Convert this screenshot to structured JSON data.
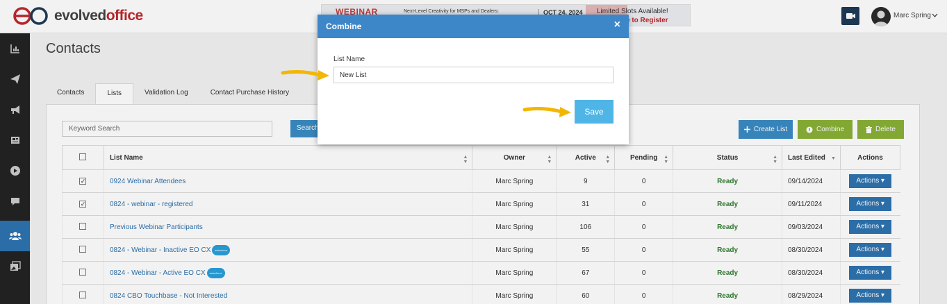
{
  "header": {
    "logo_prefix": "evolved",
    "logo_suffix": "office",
    "banner": {
      "tag": "WEBINAR",
      "description": "Next-Level Creativity for MSPs and Dealers:",
      "date": "OCT 24, 2024",
      "limited": "Limited Slots Available!",
      "register": "e to Register"
    },
    "user_name": "Marc Spring"
  },
  "sidebar": {
    "icons": [
      "dashboard-icon",
      "send-icon",
      "megaphone-icon",
      "newspaper-icon",
      "play-icon",
      "chat-icon",
      "contacts-icon",
      "gallery-icon"
    ],
    "active": "contacts-icon"
  },
  "page": {
    "title": "Contacts"
  },
  "tabs": [
    {
      "label": "Contacts",
      "active": false
    },
    {
      "label": "Lists",
      "active": true
    },
    {
      "label": "Validation Log",
      "active": false
    },
    {
      "label": "Contact Purchase History",
      "active": false
    }
  ],
  "toolbar": {
    "keyword_placeholder": "Keyword Search",
    "search_label": "Search",
    "create_label": "Create List",
    "combine_label": "Combine",
    "delete_label": "Delete"
  },
  "table": {
    "columns": [
      "List Name",
      "Owner",
      "Active",
      "Pending",
      "Status",
      "Last Edited",
      "Actions"
    ],
    "rows": [
      {
        "checked": true,
        "name": "0924 Webinar Attendees",
        "salesforce": false,
        "owner": "Marc Spring",
        "active": "9",
        "pending": "0",
        "status": "Ready",
        "last_edited": "09/14/2024",
        "action": "Actions"
      },
      {
        "checked": true,
        "name": "0824 - webinar - registered",
        "salesforce": false,
        "owner": "Marc Spring",
        "active": "31",
        "pending": "0",
        "status": "Ready",
        "last_edited": "09/11/2024",
        "action": "Actions"
      },
      {
        "checked": false,
        "name": "Previous Webinar Participants",
        "salesforce": false,
        "owner": "Marc Spring",
        "active": "106",
        "pending": "0",
        "status": "Ready",
        "last_edited": "09/03/2024",
        "action": "Actions"
      },
      {
        "checked": false,
        "name": "0824 - Webinar - Inactive EO CX",
        "salesforce": true,
        "owner": "Marc Spring",
        "active": "55",
        "pending": "0",
        "status": "Ready",
        "last_edited": "08/30/2024",
        "action": "Actions"
      },
      {
        "checked": false,
        "name": "0824 - Webinar - Active EO CX",
        "salesforce": true,
        "owner": "Marc Spring",
        "active": "67",
        "pending": "0",
        "status": "Ready",
        "last_edited": "08/30/2024",
        "action": "Actions"
      },
      {
        "checked": false,
        "name": "0824 CBO Touchbase - Not Interested",
        "salesforce": false,
        "owner": "Marc Spring",
        "active": "60",
        "pending": "0",
        "status": "Ready",
        "last_edited": "08/29/2024",
        "action": "Actions"
      }
    ]
  },
  "modal": {
    "title": "Combine",
    "close": "×",
    "field_label": "List Name",
    "field_value": "New List",
    "save_label": "Save"
  },
  "colors": {
    "brand_red": "#c0262d",
    "primary_blue": "#2e73b0",
    "modal_header": "#3d87c9",
    "save_button": "#4fb5e6",
    "green_button": "#8ab236",
    "ready_green": "#2f7d2f",
    "annotation_arrow": "#f2b705"
  }
}
